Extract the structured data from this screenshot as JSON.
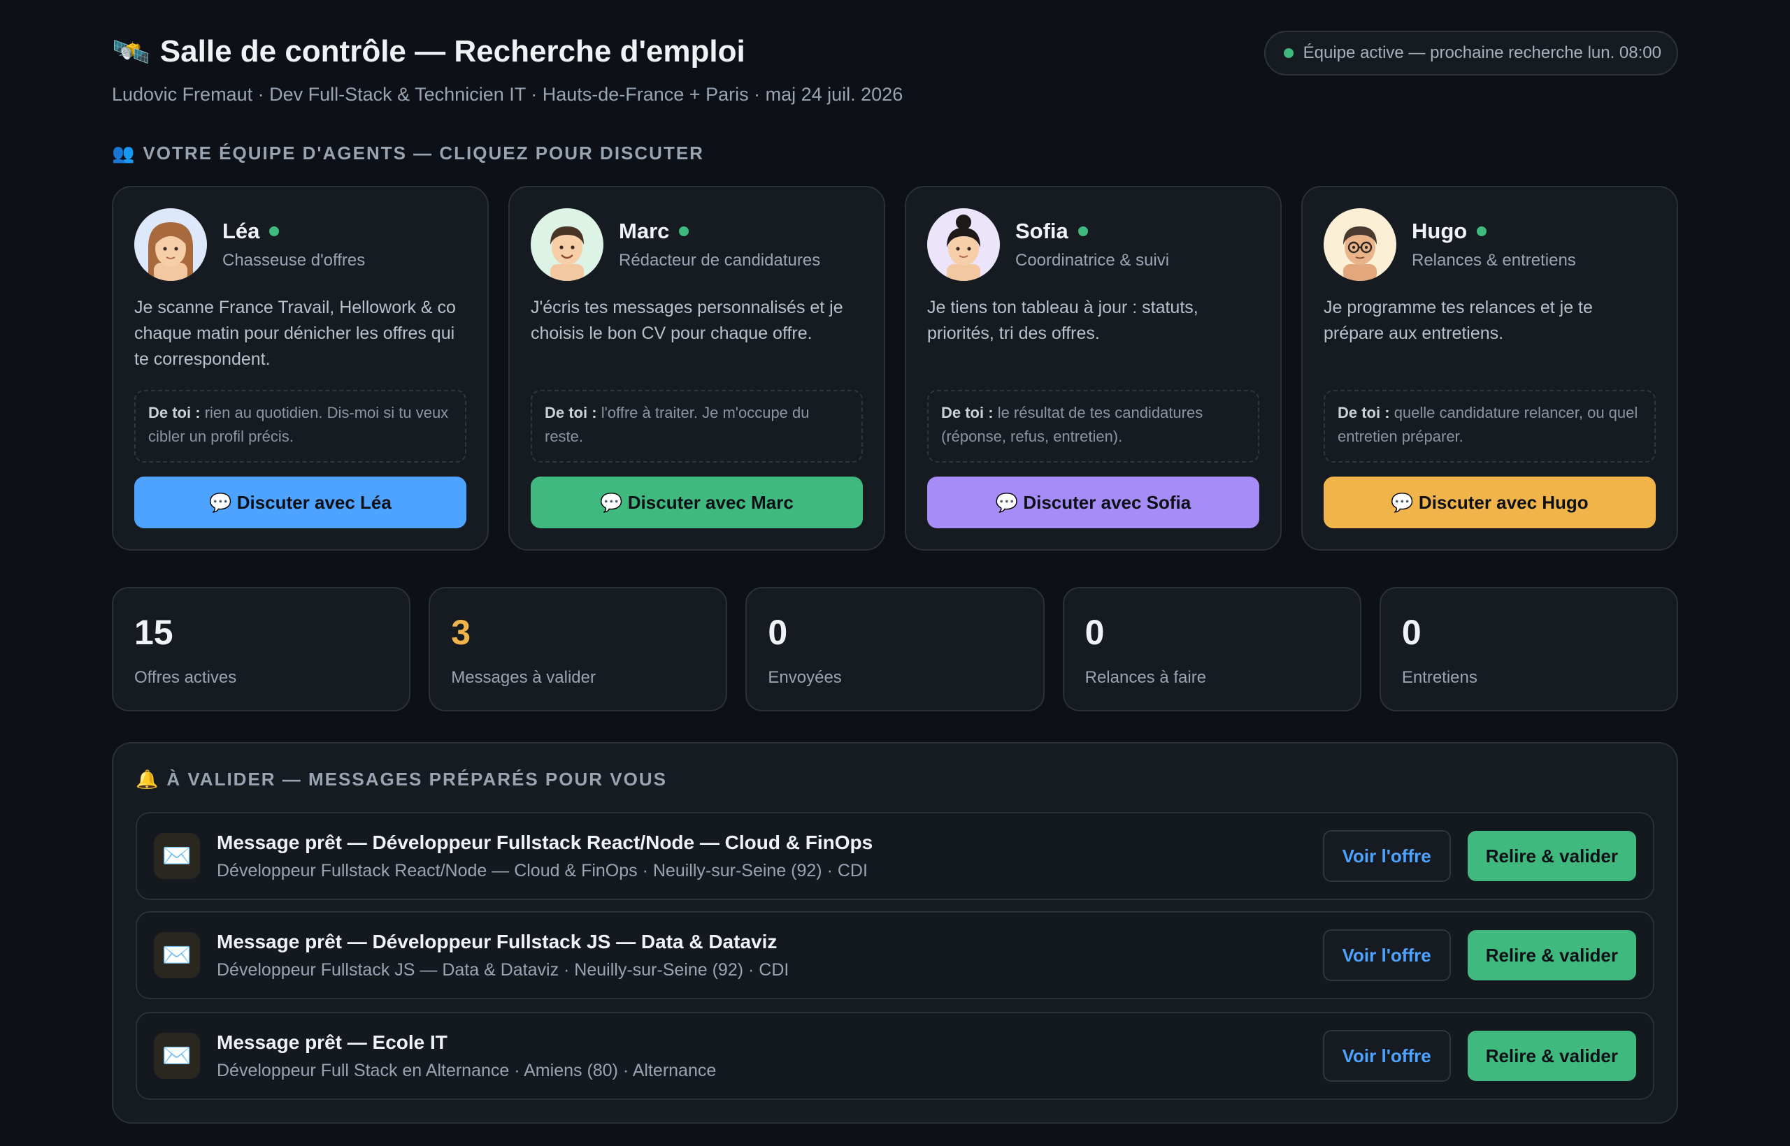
{
  "header": {
    "icon": "🛰️",
    "title": "Salle de contrôle — Recherche d'emploi",
    "subtitle": "Ludovic Fremaut · Dev Full-Stack & Technicien IT · Hauts-de-France + Paris · maj 24 juil. 2026",
    "status": "Équipe active — prochaine recherche lun. 08:00"
  },
  "team_section": {
    "icon": "👥",
    "label": "Votre équipe d'agents — cliquez pour discuter"
  },
  "agents": [
    {
      "name": "Léa",
      "role": "Chasseuse d'offres",
      "description": "Je scanne France Travail, Hellowork & co chaque matin pour dénicher les offres qui te correspondent.",
      "note_label": "De toi :",
      "note_text": "rien au quotidien. Dis-moi si tu veux cibler un profil précis.",
      "button": "💬 Discuter avec Léa",
      "color": "#4da3ff",
      "avatar_bg": "#dde9fb"
    },
    {
      "name": "Marc",
      "role": "Rédacteur de candidatures",
      "description": "J'écris tes messages personnalisés et je choisis le bon CV pour chaque offre.",
      "note_label": "De toi :",
      "note_text": "l'offre à traiter. Je m'occupe du reste.",
      "button": "💬 Discuter avec Marc",
      "color": "#3fb97e",
      "avatar_bg": "#dcf3e6"
    },
    {
      "name": "Sofia",
      "role": "Coordinatrice & suivi",
      "description": "Je tiens ton tableau à jour : statuts, priorités, tri des offres.",
      "note_label": "De toi :",
      "note_text": "le résultat de tes candidatures (réponse, refus, entretien).",
      "button": "💬 Discuter avec Sofia",
      "color": "#a68cf6",
      "avatar_bg": "#ece4fb"
    },
    {
      "name": "Hugo",
      "role": "Relances & entretiens",
      "description": "Je programme tes relances et je te prépare aux entretiens.",
      "note_label": "De toi :",
      "note_text": "quelle candidature relancer, ou quel entretien préparer.",
      "button": "💬 Discuter avec Hugo",
      "color": "#f0b44a",
      "avatar_bg": "#fbf0d6"
    }
  ],
  "stats": [
    {
      "value": "15",
      "label": "Offres actives",
      "color": "#f0f3f6"
    },
    {
      "value": "3",
      "label": "Messages à valider",
      "color": "#f0b44a"
    },
    {
      "value": "0",
      "label": "Envoyées",
      "color": "#f0f3f6"
    },
    {
      "value": "0",
      "label": "Relances à faire",
      "color": "#f0f3f6"
    },
    {
      "value": "0",
      "label": "Entretiens",
      "color": "#f0f3f6"
    }
  ],
  "validation_section": {
    "icon": "🔔",
    "label": "À valider — messages préparés pour vous",
    "items": [
      {
        "icon": "✉️",
        "title": "Message prêt — Développeur Fullstack React/Node — Cloud & FinOps",
        "subtitle": "Développeur Fullstack React/Node — Cloud & FinOps · Neuilly-sur-Seine (92) · CDI",
        "view_label": "Voir l'offre",
        "validate_label": "Relire & valider"
      },
      {
        "icon": "✉️",
        "title": "Message prêt — Développeur Fullstack JS — Data & Dataviz",
        "subtitle": "Développeur Fullstack JS — Data & Dataviz · Neuilly-sur-Seine (92) · CDI",
        "view_label": "Voir l'offre",
        "validate_label": "Relire & valider"
      },
      {
        "icon": "✉️",
        "title": "Message prêt — Ecole IT",
        "subtitle": "Développeur Full Stack en Alternance · Amiens (80) · Alternance",
        "view_label": "Voir l'offre",
        "validate_label": "Relire & valider"
      }
    ]
  }
}
